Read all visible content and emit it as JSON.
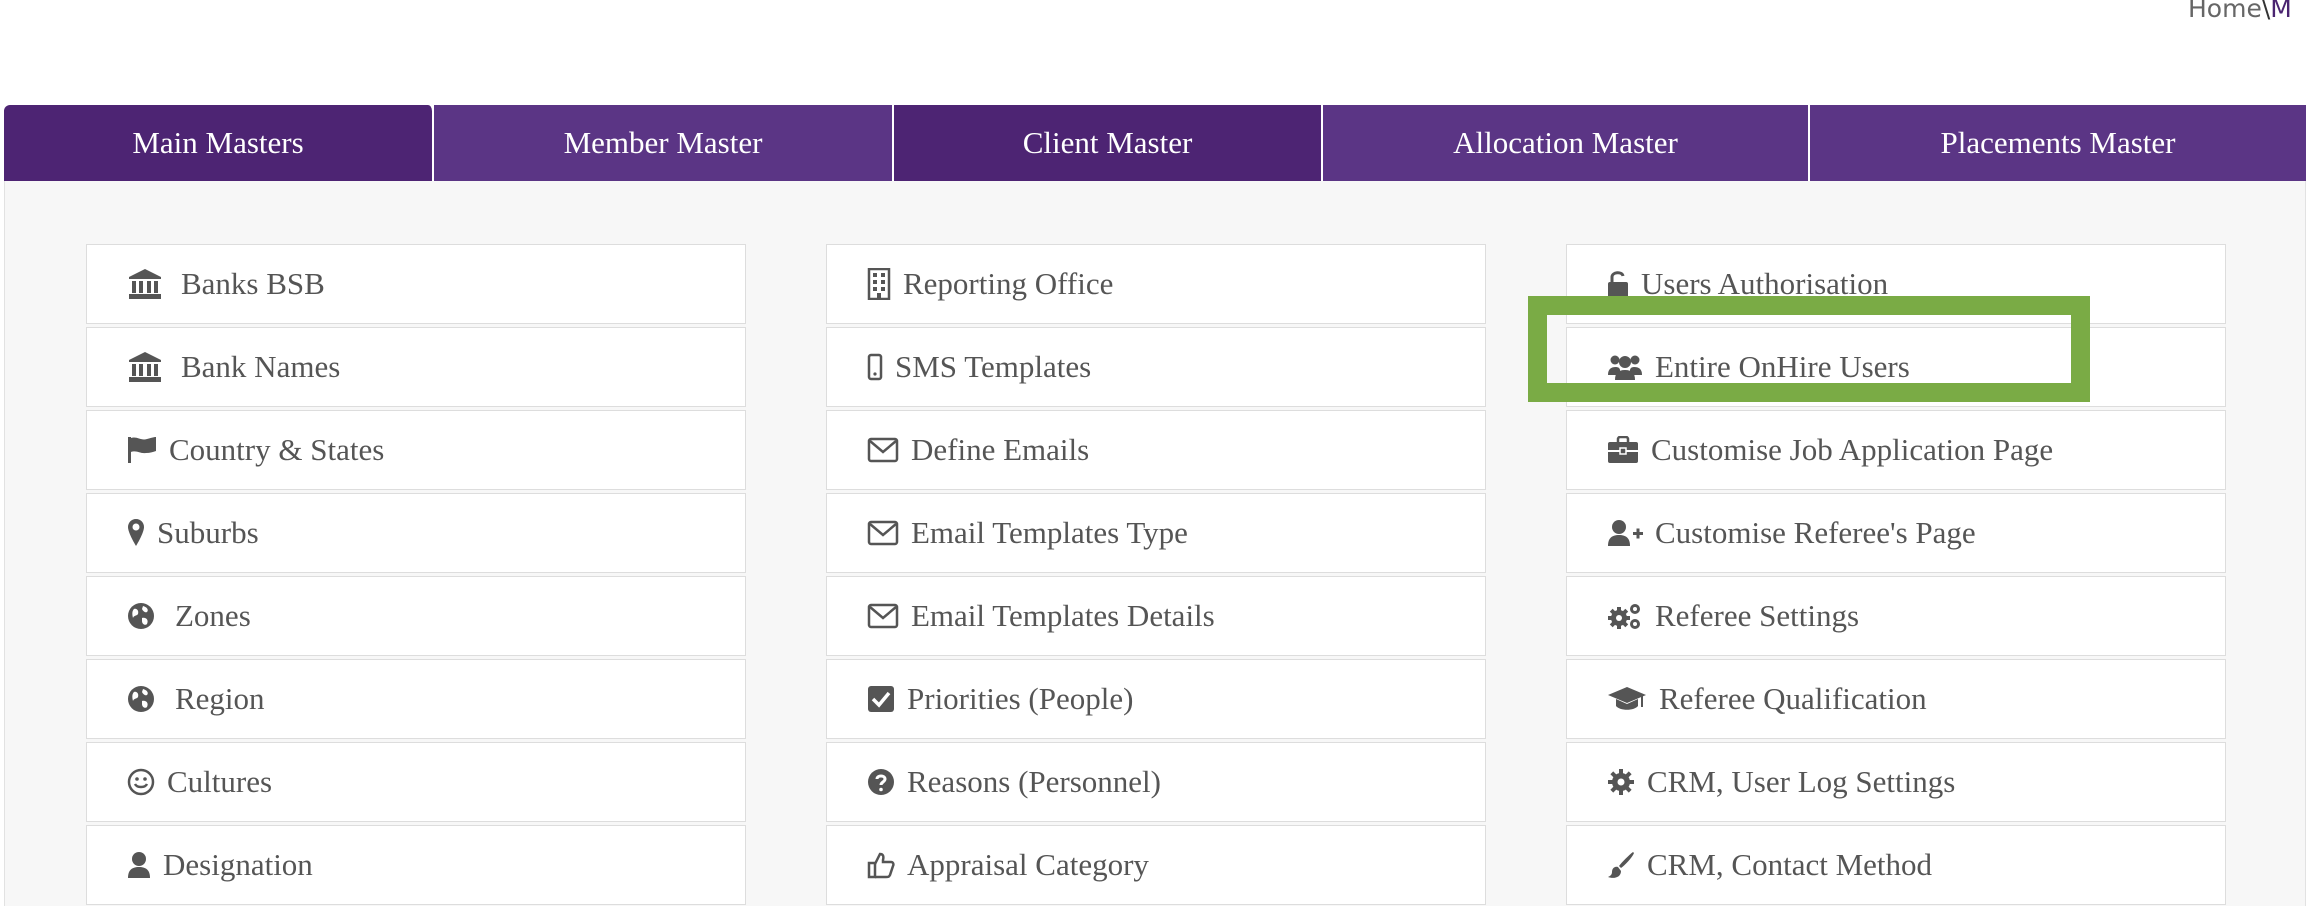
{
  "breadcrumb": {
    "home": "Home",
    "separator": "\\",
    "current": "M"
  },
  "tabs": [
    {
      "label": "Main Masters"
    },
    {
      "label": "Member Master"
    },
    {
      "label": "Client Master"
    },
    {
      "label": "Allocation Master"
    },
    {
      "label": "Placements Master"
    }
  ],
  "columns": [
    {
      "items": [
        {
          "label": "Banks BSB",
          "icon": "bank-icon"
        },
        {
          "label": "Bank Names",
          "icon": "bank-icon"
        },
        {
          "label": "Country & States",
          "icon": "flag-icon"
        },
        {
          "label": "Suburbs",
          "icon": "map-marker-icon"
        },
        {
          "label": "Zones",
          "icon": "globe-icon"
        },
        {
          "label": "Region",
          "icon": "globe-icon"
        },
        {
          "label": "Cultures",
          "icon": "smile-icon"
        },
        {
          "label": "Designation",
          "icon": "user-icon"
        }
      ]
    },
    {
      "items": [
        {
          "label": "Reporting Office",
          "icon": "building-icon"
        },
        {
          "label": "SMS Templates",
          "icon": "mobile-icon"
        },
        {
          "label": "Define Emails",
          "icon": "envelope-icon"
        },
        {
          "label": "Email Templates Type",
          "icon": "envelope-icon"
        },
        {
          "label": "Email Templates Details",
          "icon": "envelope-icon"
        },
        {
          "label": "Priorities (People)",
          "icon": "check-square-icon"
        },
        {
          "label": "Reasons (Personnel)",
          "icon": "question-circle-icon"
        },
        {
          "label": "Appraisal Category",
          "icon": "thumbs-up-icon"
        }
      ]
    },
    {
      "items": [
        {
          "label": "Users Authorisation",
          "icon": "unlock-icon"
        },
        {
          "label": "Entire OnHire Users",
          "icon": "users-icon"
        },
        {
          "label": "Customise Job Application Page",
          "icon": "briefcase-icon"
        },
        {
          "label": "Customise Referee's Page",
          "icon": "user-plus-icon"
        },
        {
          "label": "Referee Settings",
          "icon": "cogs-icon"
        },
        {
          "label": "Referee Qualification",
          "icon": "graduation-cap-icon"
        },
        {
          "label": "CRM, User Log Settings",
          "icon": "cog-icon"
        },
        {
          "label": "CRM, Contact Method",
          "icon": "paint-brush-icon"
        }
      ]
    }
  ],
  "colors": {
    "tab_primary": "#4d2473",
    "tab_secondary": "#5b3585",
    "highlight": "#7aab45",
    "text": "#555555"
  }
}
